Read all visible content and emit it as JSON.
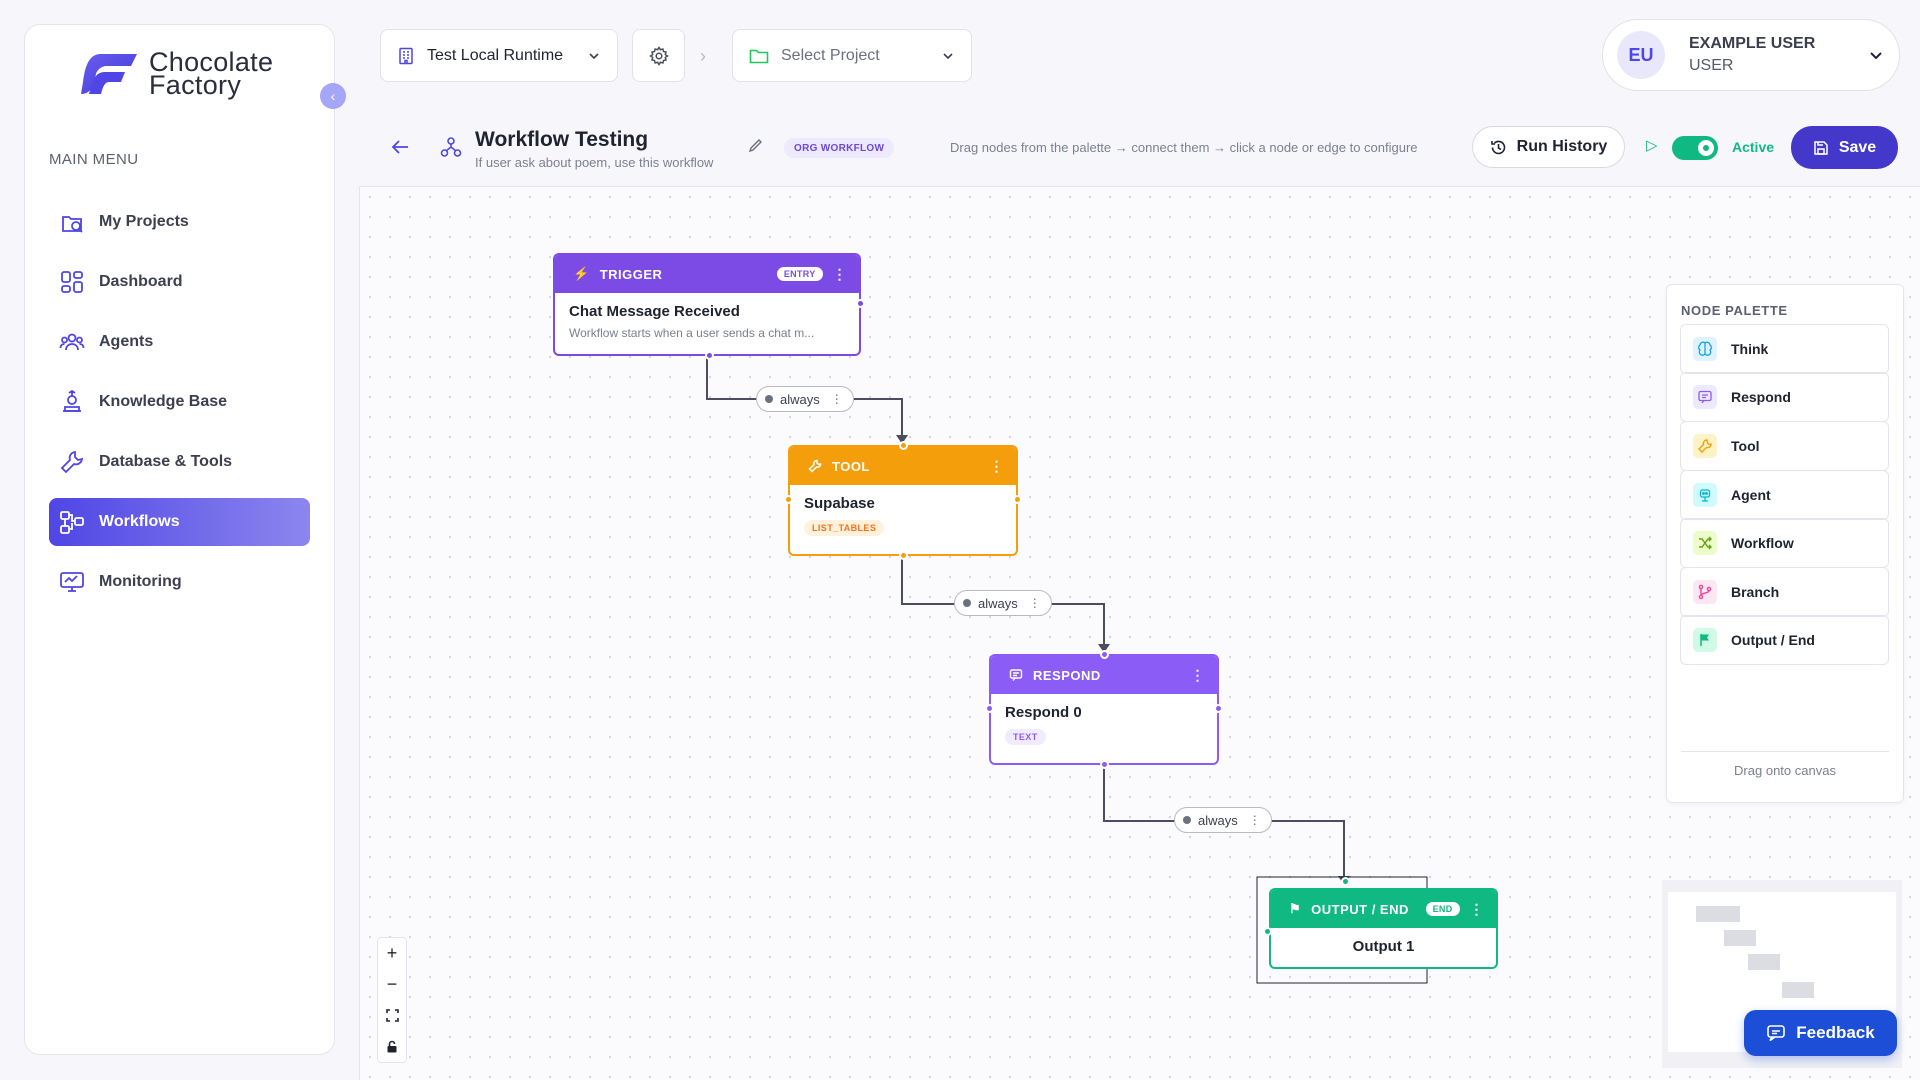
{
  "app": {
    "logo_line1": "Chocolate",
    "logo_line2": "Factory",
    "brand_color": "#4f46e5"
  },
  "sidebar": {
    "menu_title": "MAIN MENU",
    "items": [
      {
        "label": "My Projects",
        "icon": "projects-icon",
        "active": false
      },
      {
        "label": "Dashboard",
        "icon": "dashboard-icon",
        "active": false
      },
      {
        "label": "Agents",
        "icon": "agents-icon",
        "active": false
      },
      {
        "label": "Knowledge Base",
        "icon": "knowledge-icon",
        "active": false
      },
      {
        "label": "Database & Tools",
        "icon": "tools-icon",
        "active": false
      },
      {
        "label": "Workflows",
        "icon": "workflow-icon",
        "active": true
      },
      {
        "label": "Monitoring",
        "icon": "monitoring-icon",
        "active": false
      }
    ]
  },
  "topbar": {
    "runtime": "Test Local Runtime",
    "project_placeholder": "Select Project",
    "user_initials": "EU",
    "user_name": "EXAMPLE USER",
    "user_role": "USER"
  },
  "workflow": {
    "title": "Workflow Testing",
    "subtitle": "If user ask about poem, use this workflow",
    "badge": "ORG WORKFLOW",
    "hint": "Drag nodes from the palette → connect them → click a node or edge to configure",
    "run_history": "Run History",
    "active_label": "Active",
    "active": true,
    "save": "Save"
  },
  "nodes": {
    "trigger": {
      "type": "TRIGGER",
      "pill": "ENTRY",
      "name": "Chat Message Received",
      "desc": "Workflow starts when a user sends a chat m...",
      "color": "#7c4be6"
    },
    "tool": {
      "type": "TOOL",
      "name": "Supabase",
      "tag": "LIST_TABLES",
      "color": "#f59e0b"
    },
    "respond": {
      "type": "RESPOND",
      "name": "Respond 0",
      "tag": "TEXT",
      "color": "#8b5cf6"
    },
    "output": {
      "type": "OUTPUT / END",
      "pill": "END",
      "name": "Output 1",
      "color": "#10b981"
    }
  },
  "edges": [
    {
      "label": "always"
    },
    {
      "label": "always"
    },
    {
      "label": "always"
    }
  ],
  "palette": {
    "title": "NODE PALETTE",
    "items": [
      {
        "label": "Think",
        "icon": "brain-icon",
        "color": "#0ea5e9"
      },
      {
        "label": "Respond",
        "icon": "message-icon",
        "color": "#8b5cf6"
      },
      {
        "label": "Tool",
        "icon": "wrench-icon",
        "color": "#f59e0b"
      },
      {
        "label": "Agent",
        "icon": "robot-icon",
        "color": "#06b6d4"
      },
      {
        "label": "Workflow",
        "icon": "shuffle-icon",
        "color": "#84cc16"
      },
      {
        "label": "Branch",
        "icon": "branch-icon",
        "color": "#ec4899"
      },
      {
        "label": "Output / End",
        "icon": "flag-icon",
        "color": "#10b981"
      }
    ],
    "footer": "Drag onto canvas"
  },
  "feedback": "Feedback"
}
